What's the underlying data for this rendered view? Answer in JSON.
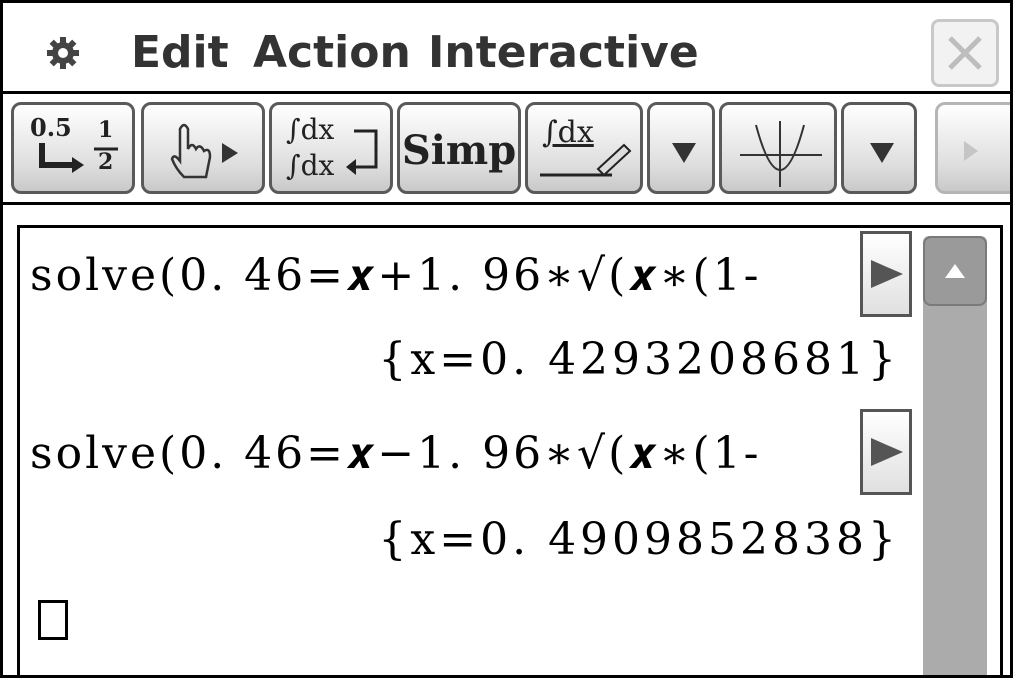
{
  "menu": {
    "edit": "Edit",
    "action": "Action",
    "interactive": "Interactive",
    "gear_icon": "gear-icon",
    "close_icon": "close-icon"
  },
  "toolbar": {
    "convert_top": "0.5",
    "convert_num": "1",
    "convert_den": "2",
    "integral_top": "∫dx",
    "integral_bottom": "∫dx",
    "simp_label": "Simp",
    "integral_draw": "∫dx",
    "dropdown_icon": "triangle-down-icon",
    "graph_icon": "graph-icon",
    "more_icon": "triangle-right-icon"
  },
  "work": {
    "lines": [
      {
        "input": "solve(0. 46=𝒙+1. 96∗√(𝒙∗(1-",
        "result": "{x=0. 4293208681}"
      },
      {
        "input": "solve(0. 46=𝒙−1. 96∗√(𝒙∗(1-",
        "result": "{x=0. 4909852838}"
      }
    ]
  },
  "colors": {
    "border": "#000000",
    "button_border": "#5a5a5a",
    "scrollbar": "#ababab"
  }
}
